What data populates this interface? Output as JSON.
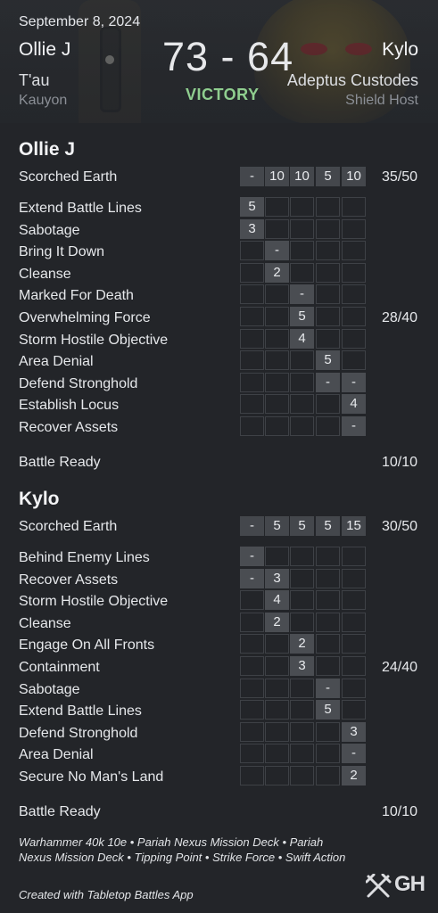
{
  "header": {
    "date": "September 8, 2024",
    "player1": {
      "name": "Ollie J",
      "faction": "T'au",
      "detachment": "Kauyon"
    },
    "player2": {
      "name": "Kylo",
      "faction": "Adeptus Custodes",
      "detachment": "Shield Host"
    },
    "score": "73 - 64",
    "result": "VICTORY",
    "result_color": "#8fce8f"
  },
  "players": [
    {
      "name": "Ollie J",
      "primary": {
        "label": "Scorched Earth",
        "rounds": [
          "-",
          "10",
          "10",
          "5",
          "10"
        ],
        "total": "35/50"
      },
      "secondaries": [
        {
          "label": "Extend Battle Lines",
          "round": 1,
          "value": "5"
        },
        {
          "label": "Sabotage",
          "round": 1,
          "value": "3"
        },
        {
          "label": "Bring It Down",
          "round": 2,
          "value": "-"
        },
        {
          "label": "Cleanse",
          "round": 2,
          "value": "2"
        },
        {
          "label": "Marked For Death",
          "round": 3,
          "value": "-"
        },
        {
          "label": "Overwhelming Force",
          "round": 3,
          "value": "5"
        },
        {
          "label": "Storm Hostile Objective",
          "round": 3,
          "value": "4"
        },
        {
          "label": "Area Denial",
          "round": 4,
          "value": "5"
        },
        {
          "label": "Defend Stronghold",
          "round": 4,
          "value": "-",
          "extra": {
            "round": 5,
            "value": "-"
          }
        },
        {
          "label": "Establish Locus",
          "round": 5,
          "value": "4"
        },
        {
          "label": "Recover Assets",
          "round": 5,
          "value": "-"
        }
      ],
      "secondary_total": "28/40",
      "battle_ready": {
        "label": "Battle Ready",
        "total": "10/10"
      }
    },
    {
      "name": "Kylo",
      "primary": {
        "label": "Scorched Earth",
        "rounds": [
          "-",
          "5",
          "5",
          "5",
          "15"
        ],
        "total": "30/50"
      },
      "secondaries": [
        {
          "label": "Behind Enemy Lines",
          "round": 1,
          "value": "-"
        },
        {
          "label": "Recover Assets",
          "round": 1,
          "value": "-",
          "extra": {
            "round": 2,
            "value": "3"
          }
        },
        {
          "label": "Storm Hostile Objective",
          "round": 2,
          "value": "4"
        },
        {
          "label": "Cleanse",
          "round": 2,
          "value": "2"
        },
        {
          "label": "Engage On All Fronts",
          "round": 3,
          "value": "2"
        },
        {
          "label": "Containment",
          "round": 3,
          "value": "3"
        },
        {
          "label": "Sabotage",
          "round": 4,
          "value": "-"
        },
        {
          "label": "Extend Battle Lines",
          "round": 4,
          "value": "5"
        },
        {
          "label": "Defend Stronghold",
          "round": 5,
          "value": "3"
        },
        {
          "label": "Area Denial",
          "round": 5,
          "value": "-"
        },
        {
          "label": "Secure No Man's Land",
          "round": 5,
          "value": "2"
        }
      ],
      "secondary_total": "24/40",
      "battle_ready": {
        "label": "Battle Ready",
        "total": "10/10"
      }
    }
  ],
  "footer": {
    "info": "Warhammer 40k 10e • Pariah Nexus Mission Deck • Pariah Nexus Mission Deck • Tipping Point • Strike Force • Swift Action",
    "credit": "Created with Tabletop Battles App",
    "logo_text": "GH",
    "logo_icon": "crossed-swords-icon"
  }
}
